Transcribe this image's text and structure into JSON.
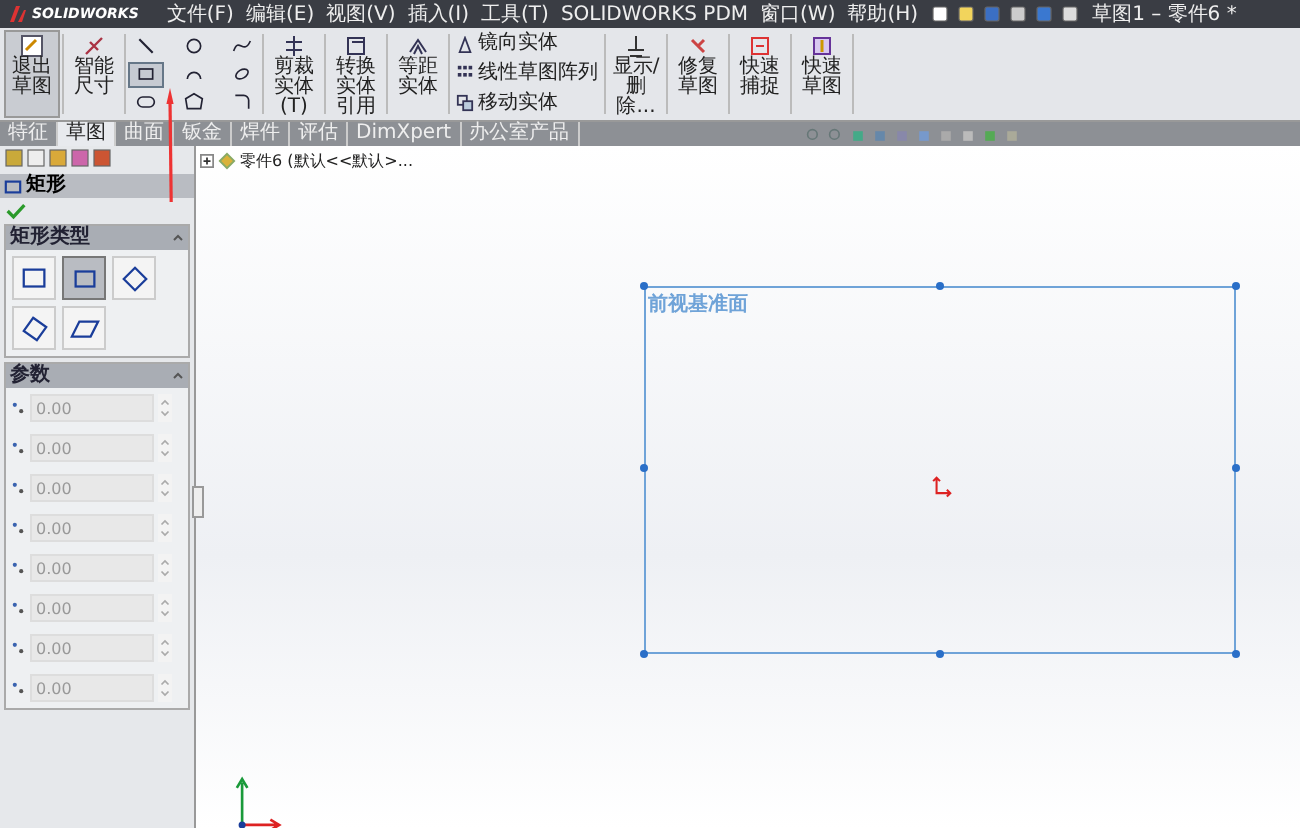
{
  "app": {
    "brand": "SOLIDWORKS"
  },
  "menu": [
    "文件(F)",
    "编辑(E)",
    "视图(V)",
    "插入(I)",
    "工具(T)",
    "SOLIDWORKS PDM",
    "窗口(W)",
    "帮助(H)"
  ],
  "window": {
    "title": "草图1 – 零件6 *"
  },
  "ribbon": [
    {
      "kind": "large",
      "label": "退出草图",
      "selected": true
    },
    {
      "kind": "large",
      "label": "智能尺寸",
      "selected": false
    },
    {
      "kind": "tools",
      "tools": [
        {
          "selected": false
        },
        {
          "selected": false
        },
        {
          "selected": false
        },
        {
          "selected": true
        },
        {
          "selected": false
        },
        {
          "selected": false
        },
        {
          "selected": false
        },
        {
          "selected": false
        },
        {
          "selected": false
        }
      ]
    },
    {
      "kind": "large",
      "label": "剪裁实体(T)",
      "selected": false
    },
    {
      "kind": "large",
      "label": "转换实体引用",
      "selected": false
    },
    {
      "kind": "large",
      "label": "等距实体",
      "selected": false
    },
    {
      "kind": "small",
      "items": [
        {
          "label": "镜向实体"
        },
        {
          "label": "线性草图阵列"
        },
        {
          "label": "移动实体"
        }
      ]
    },
    {
      "kind": "large",
      "label": "显示/删除...",
      "selected": false
    },
    {
      "kind": "large",
      "label": "修复草图",
      "selected": false
    },
    {
      "kind": "large",
      "label": "快速捕捉",
      "selected": false
    },
    {
      "kind": "large",
      "label": "快速草图",
      "selected": false
    }
  ],
  "tabs": [
    {
      "label": "特征",
      "selected": false
    },
    {
      "label": "草图",
      "selected": true
    },
    {
      "label": "曲面",
      "selected": false
    },
    {
      "label": "钣金",
      "selected": false
    },
    {
      "label": "焊件",
      "selected": false
    },
    {
      "label": "评估",
      "selected": false
    },
    {
      "label": "DimXpert",
      "selected": false
    },
    {
      "label": "办公室产品",
      "selected": false
    }
  ],
  "panel": {
    "title": "矩形",
    "types_section": {
      "title": "矩形类型",
      "types": [
        {
          "selected": false
        },
        {
          "selected": true
        },
        {
          "selected": false
        },
        {
          "selected": false
        },
        {
          "selected": false
        }
      ]
    },
    "params_section": {
      "title": "参数",
      "fields": [
        {
          "value": "0.00"
        },
        {
          "value": "0.00"
        },
        {
          "value": "0.00"
        },
        {
          "value": "0.00"
        },
        {
          "value": "0.00"
        },
        {
          "value": "0.00"
        },
        {
          "value": "0.00"
        },
        {
          "value": "0.00"
        }
      ]
    }
  },
  "tree": {
    "label": "零件6 (默认<<默认>...",
    "expanded": false
  },
  "canvas": {
    "plane_label": "前视基准面"
  }
}
